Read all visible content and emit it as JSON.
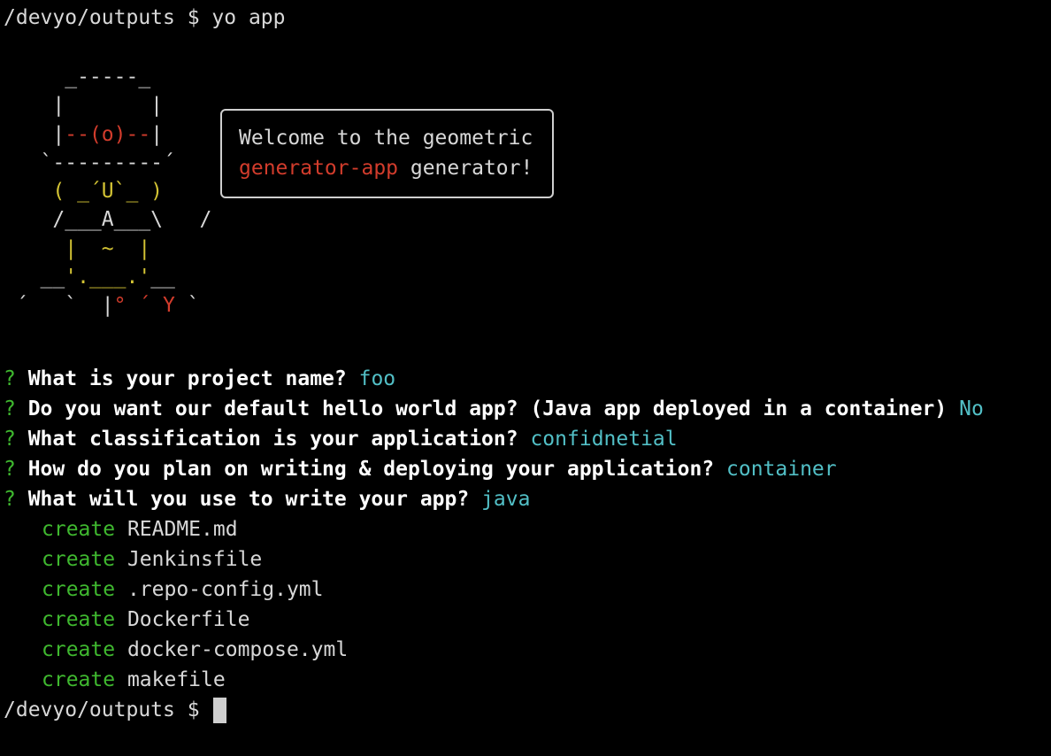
{
  "terminal": {
    "command_line": {
      "prompt": "/devyo/outputs $ ",
      "command": "yo app"
    },
    "ascii_art": [
      {
        "segments": [
          {
            "text": "     _-----_",
            "color": "gray"
          }
        ]
      },
      {
        "segments": [
          {
            "text": "    |       |",
            "color": "gray"
          }
        ]
      },
      {
        "segments": [
          {
            "text": "    |",
            "color": "gray"
          },
          {
            "text": "--(o)--",
            "color": "red"
          },
          {
            "text": "|",
            "color": "gray"
          }
        ]
      },
      {
        "segments": [
          {
            "text": "   `---------´",
            "color": "gray"
          }
        ]
      },
      {
        "segments": [
          {
            "text": "    ( _´U`_ )",
            "color": "yellow"
          }
        ]
      },
      {
        "segments": [
          {
            "text": "    /___A___\\   /",
            "color": "gray"
          }
        ]
      },
      {
        "segments": [
          {
            "text": "     |  ~  |",
            "color": "yellow"
          }
        ]
      },
      {
        "segments": [
          {
            "text": "   __",
            "color": "gray"
          },
          {
            "text": "'.___.'",
            "color": "yellow"
          },
          {
            "text": "__",
            "color": "gray"
          }
        ]
      },
      {
        "segments": [
          {
            "text": " ´   `  |",
            "color": "gray"
          },
          {
            "text": "° ´ Y",
            "color": "red"
          },
          {
            "text": " `",
            "color": "gray"
          }
        ]
      }
    ],
    "speech_bubble": {
      "line1": "Welcome to the geometric",
      "line2_highlight": "generator-app",
      "line2_rest": " generator!"
    },
    "questions": [
      {
        "mark": "?",
        "question": " What is your project name? ",
        "answer": "foo"
      },
      {
        "mark": "?",
        "question": " Do you want our default hello world app? (Java app deployed in a container) ",
        "answer": "No"
      },
      {
        "mark": "?",
        "question": " What classification is your application? ",
        "answer": "confidnetial"
      },
      {
        "mark": "?",
        "question": " How do you plan on writing & deploying your application? ",
        "answer": "container"
      },
      {
        "mark": "?",
        "question": " What will you use to write your app? ",
        "answer": "java"
      }
    ],
    "created_files": [
      {
        "action": "create",
        "file": " README.md"
      },
      {
        "action": "create",
        "file": " Jenkinsfile"
      },
      {
        "action": "create",
        "file": " .repo-config.yml"
      },
      {
        "action": "create",
        "file": " Dockerfile"
      },
      {
        "action": "create",
        "file": " docker-compose.yml"
      },
      {
        "action": "create",
        "file": " makefile"
      }
    ],
    "final_prompt": "/devyo/outputs $ "
  },
  "colors": {
    "background": "#000000",
    "text": "#d8d8d8",
    "red": "#d23c2c",
    "yellow": "#d3c334",
    "cyan": "#52bfc6",
    "green": "#3fb82f"
  }
}
